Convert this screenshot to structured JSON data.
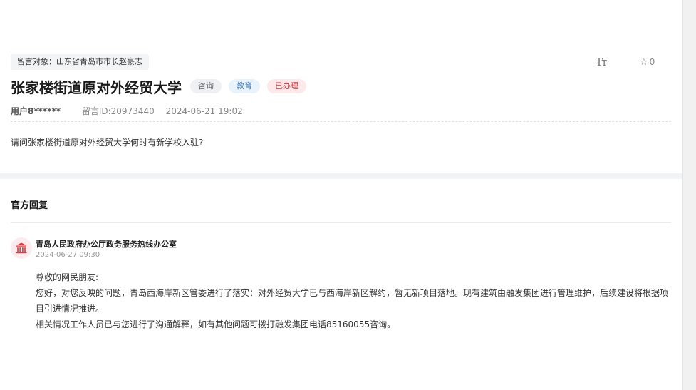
{
  "message": {
    "target_label": "留言对象：山东省青岛市市长赵豪志",
    "title": "张家楼街道原对外经贸大学",
    "tags": [
      "咨询",
      "教育",
      "已办理"
    ],
    "user": "用户8******",
    "message_id": "留言ID:20973440",
    "time": "2024-06-21 19:02",
    "content": "请问张家楼街道原对外经贸大学何时有新学校入驻?"
  },
  "toolbar": {
    "font_size_icon": "Tт",
    "favorite_count": "0"
  },
  "reply": {
    "section_title": "官方回复",
    "org_name": "青岛人民政府办公厅政务服务热线办公室",
    "time": "2024-06-27 09:30",
    "greeting": "尊敬的网民朋友:",
    "paragraph1": "您好，对您反映的问题，青岛西海岸新区管委进行了落实：对外经贸大学已与西海岸新区解约，暂无新项目落地。现有建筑由融发集团进行管理维护，后续建设将根据项目引进情况推进。",
    "paragraph2": "相关情况工作人员已与您进行了沟通解释，如有其他问题可拨打融发集团电话85160055咨询。"
  },
  "icons": {
    "font_size": "font-size-icon",
    "favorite": "star-icon",
    "organization": "government-building-icon"
  },
  "colors": {
    "accent_red": "#d9363e",
    "tag_blue": "#4a7fb5"
  }
}
